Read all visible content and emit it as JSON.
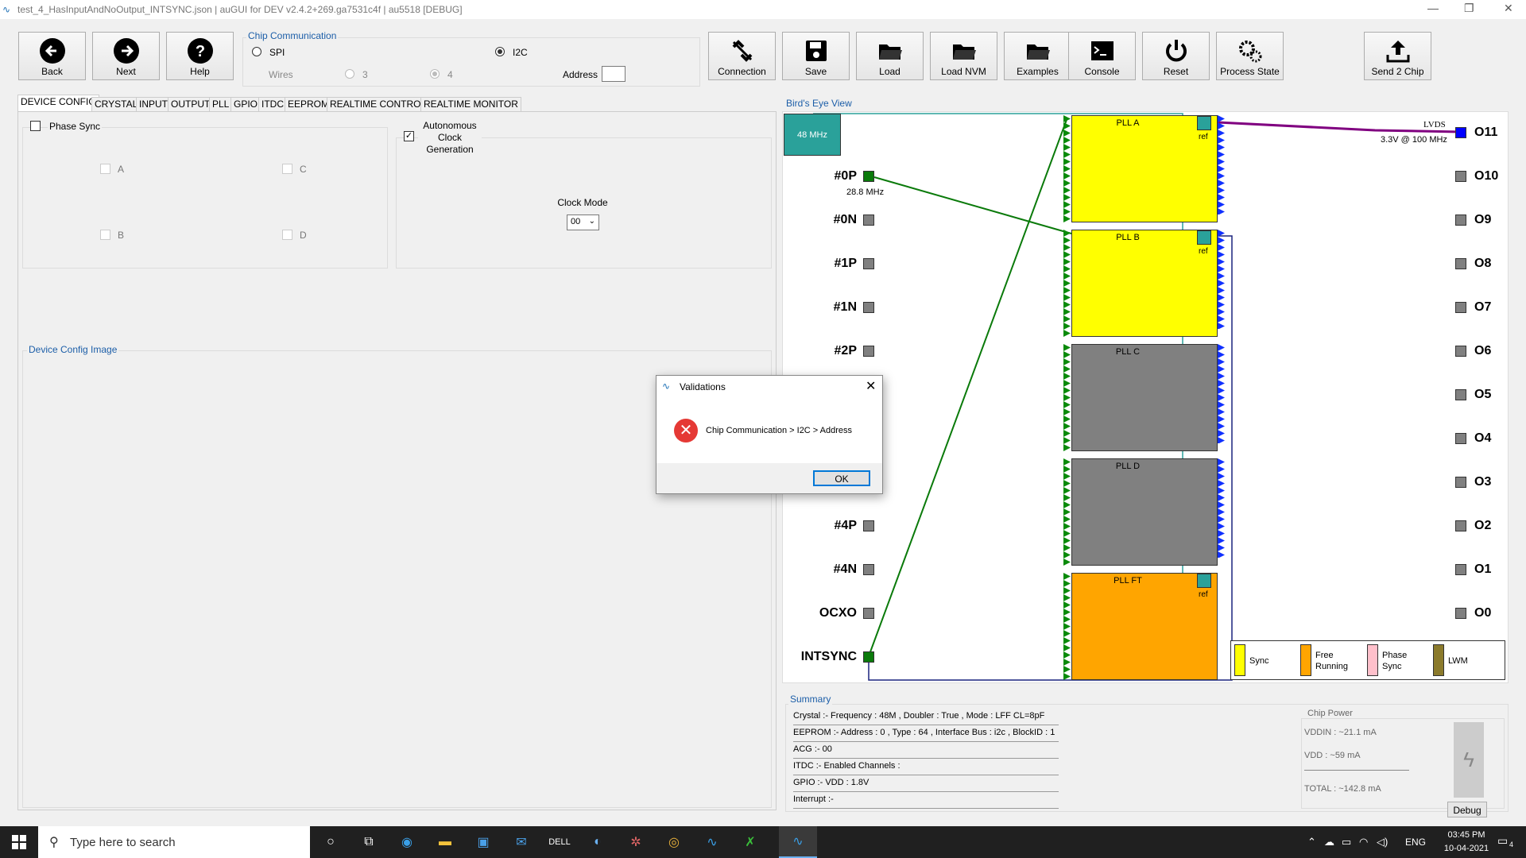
{
  "title_bar": {
    "title": "test_4_HasInputAndNoOutput_INTSYNC.json | auGUI for DEV v2.4.2+269.ga7531c4f | au5518 [DEBUG]"
  },
  "toolbar": {
    "back": "Back",
    "next": "Next",
    "help": "Help",
    "connection": "Connection",
    "save": "Save",
    "load": "Load",
    "load_nvm": "Load NVM",
    "examples": "Examples",
    "console": "Console",
    "reset": "Reset",
    "process_state": "Process State",
    "send_chip": "Send 2 Chip"
  },
  "chip_comm": {
    "title": "Chip Communication",
    "spi": "SPI",
    "i2c": "I2C",
    "wires": "Wires",
    "wire3": "3",
    "wire4": "4",
    "address": "Address",
    "address_value": ""
  },
  "tabs": [
    "DEVICE CONFIG",
    "CRYSTAL",
    "INPUT",
    "OUTPUT",
    "PLL",
    "GPIO",
    "ITDC",
    "EEPROM",
    "REALTIME CONTROL",
    "REALTIME MONITOR"
  ],
  "device_config": {
    "phase_sync": "Phase Sync",
    "a": "A",
    "b": "B",
    "c": "C",
    "d": "D",
    "acg_label": "Autonomous Clock Generation",
    "clock_mode_label": "Clock Mode",
    "clock_mode_value": "00",
    "image_title": "Device Config Image"
  },
  "birds_eye": {
    "title": "Bird's Eye View",
    "crystal": "48 MHz",
    "inputs": [
      "#0P",
      "#0N",
      "#1P",
      "#1N",
      "#2P",
      "#4P",
      "#4N",
      "OCXO",
      "INTSYNC"
    ],
    "input0_freq": "28.8 MHz",
    "plls": [
      "PLL A",
      "PLL B",
      "PLL C",
      "PLL D",
      "PLL FT"
    ],
    "ref": "ref",
    "outputs": [
      "O11",
      "O10",
      "O9",
      "O8",
      "O7",
      "O6",
      "O5",
      "O4",
      "O3",
      "O2",
      "O1",
      "O0"
    ],
    "o11_type": "LVDS",
    "o11_freq": "3.3V @ 100 MHz",
    "legend": [
      "Sync",
      "Free Running",
      "Phase Sync",
      "LWM"
    ],
    "colors": {
      "sync": "#ffff00",
      "free_running": "#ffa500",
      "phase_sync": "#ffc0cb",
      "lwm": "#8b7a2b",
      "inactive": "#808080",
      "crystal": "#2aa19a"
    }
  },
  "summary": {
    "title": "Summary",
    "rows": [
      "Crystal :-  Frequency : 48M , Doubler : True , Mode : LFF CL=8pF",
      "EEPROM :-  Address : 0 , Type : 64 , Interface Bus : i2c , BlockID : 1",
      "ACG :-  00",
      "ITDC :-  Enabled Channels :",
      "GPIO :-  VDD : 1.8V",
      "Interrupt :-"
    ]
  },
  "chip_power": {
    "title": "Chip Power",
    "vddin": "VDDIN : ~21.1  mA",
    "vdd": "VDD  : ~59  mA",
    "total": "TOTAL : ~142.8  mA",
    "debug": "Debug"
  },
  "dialog": {
    "title": "Validations",
    "message": "Chip Communication > I2C > Address",
    "ok": "OK"
  },
  "taskbar": {
    "search_placeholder": "Type here to search",
    "lang": "ENG",
    "time": "03:45 PM",
    "date": "10-04-2021",
    "notif_count": "4"
  }
}
